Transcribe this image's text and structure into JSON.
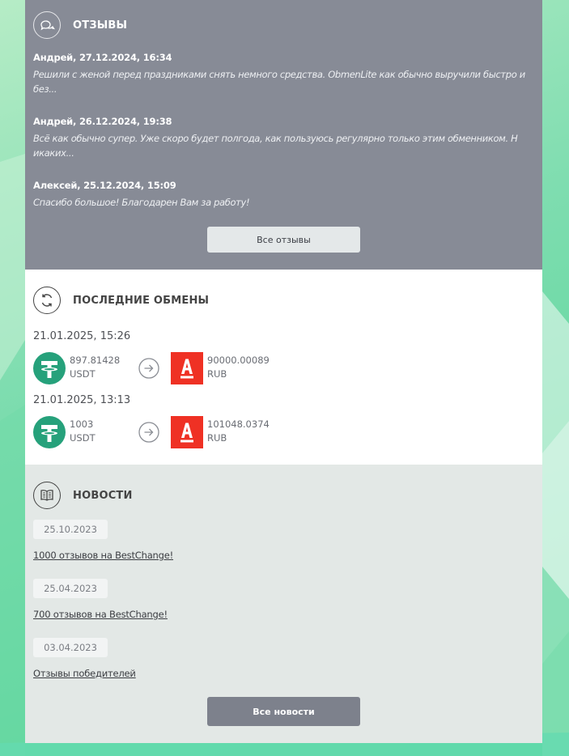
{
  "reviews": {
    "title": "ОТЗЫВЫ",
    "items": [
      {
        "author": "Андрей, 27.12.2024, 16:34",
        "text": "Решили с женой перед праздниками снять немного средства. ObmenLite как обычно выручили быстро и без..."
      },
      {
        "author": "Андрей, 26.12.2024, 19:38",
        "text": "Всё как обычно супер. Уже скоро будет полгода, как пользуюсь регулярно только этим обменником. Н икаких..."
      },
      {
        "author": "Алексей, 25.12.2024, 15:09",
        "text": "Спасибо большое! Благодарен Вам за работу!"
      }
    ],
    "all_button": "Все отзывы"
  },
  "exchanges": {
    "title": "ПОСЛЕДНИЕ ОБМЕНЫ",
    "items": [
      {
        "date": "21.01.2025, 15:26",
        "from_amount": "897.81428",
        "from_currency": "USDT",
        "to_amount": "90000.00089",
        "to_currency": "RUB"
      },
      {
        "date": "21.01.2025, 13:13",
        "from_amount": "1003",
        "from_currency": "USDT",
        "to_amount": "101048.0374",
        "to_currency": "RUB"
      }
    ]
  },
  "news": {
    "title": "НОВОСТИ",
    "items": [
      {
        "date": "25.10.2023",
        "title": "1000 отзывов на BestChange!"
      },
      {
        "date": "25.04.2023",
        "title": "700 отзывов на BestChange!"
      },
      {
        "date": "03.04.2023",
        "title": "Отзывы победителей"
      }
    ],
    "all_button": "Все новости"
  },
  "colors": {
    "reviews_bg": "#878b96",
    "news_bg": "#e3e8e6",
    "tether": "#26a17b",
    "alfa": "#ef3124"
  }
}
